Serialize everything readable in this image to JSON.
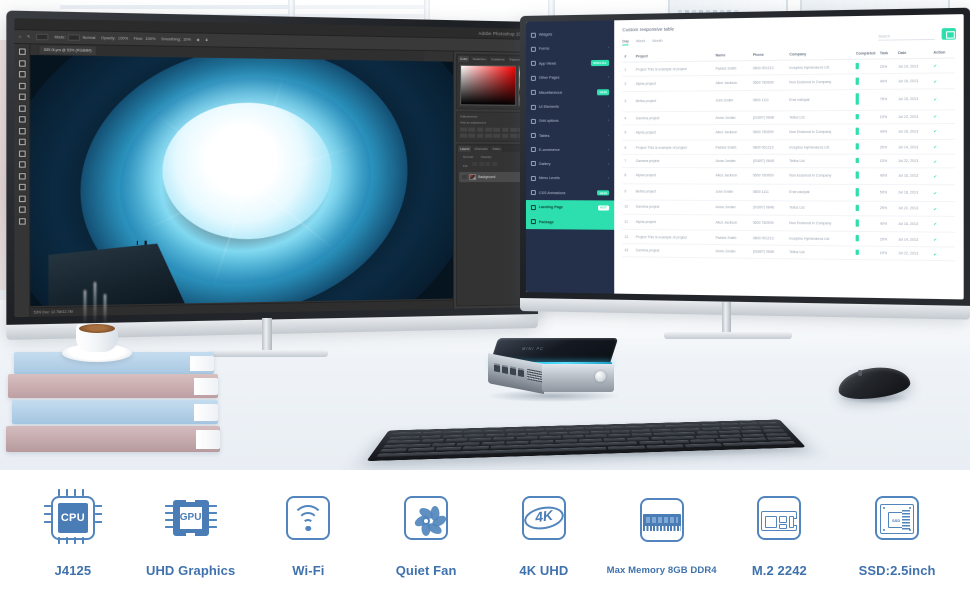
{
  "scene": {
    "description": "Mini PC product photo with dual monitors on a bright white desk"
  },
  "left_monitor": {
    "app_title": "Adobe Photoshop 2020",
    "document_tab": "839.0Lyra @ 53% (RGB/8#)",
    "options": [
      {
        "label": "Mode:",
        "value": "Normal"
      },
      {
        "label": "Opacity:",
        "value": "100%"
      },
      {
        "label": "Flow:",
        "value": "100%"
      },
      {
        "label": "Smoothing:",
        "value": "10%"
      }
    ],
    "color_panel_tabs": [
      "Color",
      "Swatches",
      "Gradients",
      "Patterns"
    ],
    "adjustments_label": "Adjustments",
    "adjustments_sub": "Add an adjustment",
    "layers_panel_tabs": [
      "Layers",
      "Channels",
      "Paths"
    ],
    "layer_blend_mode": "Normal",
    "layer_opacity_label": "Opacity:",
    "layer_fill_label": "Fill:",
    "layer_name": "Background",
    "status_bar": "53%   Doc: 12.7M/12.7M",
    "artwork_caption": "Blue ice cave vortex with cliff ledge"
  },
  "right_monitor": {
    "sidebar": [
      {
        "label": "Widgets",
        "badge": "",
        "caret": false,
        "active": false
      },
      {
        "label": "Forms",
        "badge": "",
        "caret": true,
        "active": false
      },
      {
        "label": "App Views",
        "badge": "SPECIAL",
        "caret": false,
        "active": false
      },
      {
        "label": "Other Pages",
        "badge": "",
        "caret": true,
        "active": false
      },
      {
        "label": "Miscellaneous",
        "badge": "NEW",
        "caret": false,
        "active": false
      },
      {
        "label": "UI Elements",
        "badge": "",
        "caret": true,
        "active": false
      },
      {
        "label": "Grid options",
        "badge": "",
        "caret": true,
        "active": false
      },
      {
        "label": "Tables",
        "badge": "",
        "caret": true,
        "active": false
      },
      {
        "label": "E-commerce",
        "badge": "",
        "caret": true,
        "active": false
      },
      {
        "label": "Gallery",
        "badge": "",
        "caret": true,
        "active": false
      },
      {
        "label": "Menu Levels",
        "badge": "",
        "caret": true,
        "active": false
      },
      {
        "label": "CSS Animations",
        "badge": "NEW",
        "caret": false,
        "active": false
      },
      {
        "label": "Landing Page",
        "badge": "HOT",
        "caret": false,
        "active": true
      },
      {
        "label": "Package",
        "badge": "",
        "caret": false,
        "active": true
      }
    ],
    "page_title": "Custom responsive table",
    "range_tabs": [
      "Day",
      "Week",
      "Month"
    ],
    "active_range_tab": "Day",
    "search_placeholder": "Search",
    "columns": [
      "#",
      "Project",
      "Name",
      "Phone",
      "Company",
      "Completed",
      "Task",
      "Date",
      "Action"
    ],
    "rows": [
      {
        "num": "1",
        "project": "Project This is example of project",
        "name": "Patrick Smith",
        "phone": "0800 091213",
        "company": "Inceptos Hymenaeos Ltd",
        "bar": 4,
        "task": "20%",
        "date": "Jul 14, 2013"
      },
      {
        "num": "2",
        "project": "Alpha project",
        "name": "Alice Jackson",
        "phone": "0500 780909",
        "company": "Non Euismod in Company",
        "bar": 5,
        "task": "40%",
        "date": "Jul 16, 2013"
      },
      {
        "num": "3",
        "project": "Betha project",
        "name": "John Smith",
        "phone": "0800 1111",
        "company": "Erat volutpat",
        "bar": 9,
        "task": "75%",
        "date": "Jul 18, 2013"
      },
      {
        "num": "4",
        "project": "Gamma project",
        "name": "Anna Jordan",
        "phone": "(01697) 0648",
        "company": "Tellus Ltd",
        "bar": 3,
        "task": "10%",
        "date": "Jul 22, 2013"
      },
      {
        "num": "5",
        "project": "Alpha project",
        "name": "Alice Jackson",
        "phone": "0500 780909",
        "company": "Non Euismod in Company",
        "bar": 5,
        "task": "40%",
        "date": "Jul 16, 2013"
      },
      {
        "num": "6",
        "project": "Project This is example of project",
        "name": "Patrick Smith",
        "phone": "0800 091213",
        "company": "Inceptos Hymenaeos Ltd",
        "bar": 4,
        "task": "20%",
        "date": "Jul 14, 2013"
      },
      {
        "num": "7",
        "project": "Gamma project",
        "name": "Anna Jordan",
        "phone": "(01697) 0648",
        "company": "Tellus Ltd",
        "bar": 3,
        "task": "10%",
        "date": "Jul 22, 2013"
      },
      {
        "num": "8",
        "project": "Alpha project",
        "name": "Alice Jackson",
        "phone": "0500 780909",
        "company": "Non Euismod in Company",
        "bar": 5,
        "task": "40%",
        "date": "Jul 16, 2013"
      },
      {
        "num": "9",
        "project": "Betha project",
        "name": "John Smith",
        "phone": "0800 1111",
        "company": "Erat volutpat",
        "bar": 6,
        "task": "50%",
        "date": "Jul 18, 2013"
      },
      {
        "num": "10",
        "project": "Gamma project",
        "name": "Anna Jordan",
        "phone": "(01697) 0648",
        "company": "Tellus Ltd",
        "bar": 4,
        "task": "25%",
        "date": "Jul 22, 2013"
      },
      {
        "num": "11",
        "project": "Alpha project",
        "name": "Alice Jackson",
        "phone": "0500 780909",
        "company": "Non Euismod in Company",
        "bar": 5,
        "task": "40%",
        "date": "Jul 16, 2013"
      },
      {
        "num": "12",
        "project": "Project This is example of project",
        "name": "Patrick Smith",
        "phone": "0800 091213",
        "company": "Inceptos Hymenaeos Ltd",
        "bar": 4,
        "task": "20%",
        "date": "Jul 14, 2013"
      },
      {
        "num": "13",
        "project": "Gamma project",
        "name": "Anna Jordan",
        "phone": "(01697) 0648",
        "company": "Tellus Ltd",
        "bar": 3,
        "task": "10%",
        "date": "Jul 22, 2013"
      }
    ]
  },
  "mini_pc": {
    "brand": "MINI PC"
  },
  "features": [
    {
      "label": "J4125",
      "icon": "cpu-chip-icon",
      "chip_text": "CPU",
      "small": false
    },
    {
      "label": "UHD Graphics",
      "icon": "gpu-chip-icon",
      "chip_text": "GPU",
      "small": false
    },
    {
      "label": "Wi-Fi",
      "icon": "wifi-icon",
      "chip_text": "",
      "small": false
    },
    {
      "label": "Quiet Fan",
      "icon": "fan-icon",
      "chip_text": "",
      "small": false
    },
    {
      "label": "4K UHD",
      "icon": "4k-icon",
      "chip_text": "4K",
      "small": false
    },
    {
      "label": "Max Memory 8GB DDR4",
      "icon": "ram-module-icon",
      "chip_text": "",
      "small": true
    },
    {
      "label": "M.2 2242",
      "icon": "m2-ssd-icon",
      "chip_text": "",
      "small": false
    },
    {
      "label": "SSD:2.5inch",
      "icon": "ssd-drive-icon",
      "chip_text": "SSD",
      "small": false
    }
  ],
  "colors": {
    "feature_blue": "#4a7db5",
    "feature_outline": "#5285bd",
    "label_blue": "#3f72ac",
    "dashboard_accent": "#2ddfae",
    "dashboard_sidebar": "#24304a",
    "pc_led": "#29c8f2"
  }
}
